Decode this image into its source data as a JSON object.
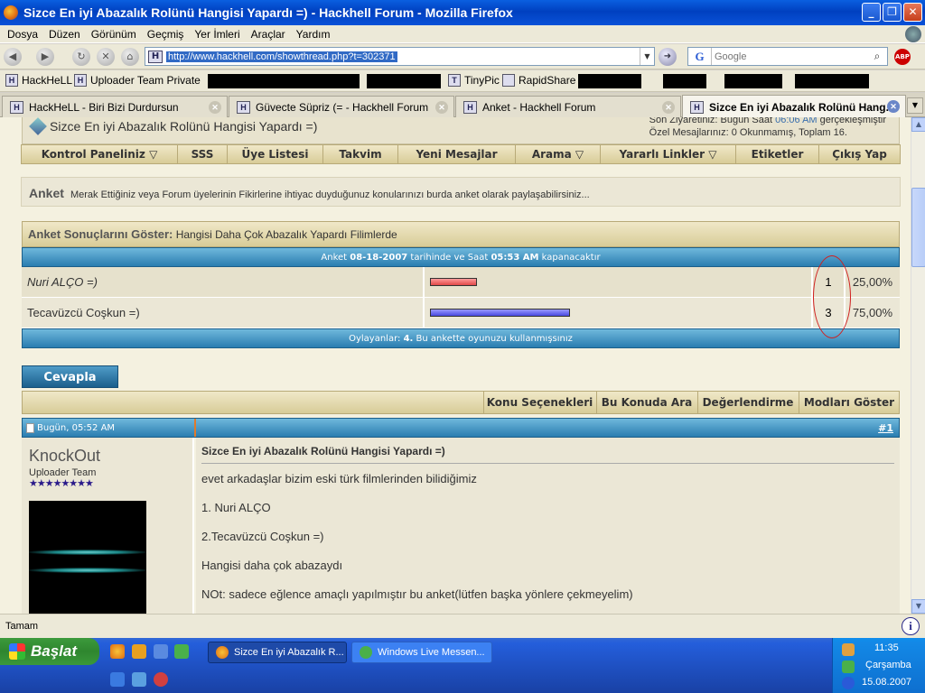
{
  "window": {
    "title": "Sizce En iyi Abazalık Rolünü Hangisi Yapardı =) - Hackhell Forum - Mozilla Firefox",
    "buttons": [
      "_",
      "❐",
      "✕"
    ]
  },
  "menu": [
    "Dosya",
    "Düzen",
    "Görünüm",
    "Geçmiş",
    "Yer İmleri",
    "Araçlar",
    "Yardım"
  ],
  "nav": {
    "url": "http://www.hackhell.com/showthread.php?t=302371",
    "search_placeholder": "Google",
    "search_engine_icon": "G",
    "abp_label": "ABP"
  },
  "bookmarks": [
    {
      "label": "HackHeLL",
      "icon": "hackhell-icon"
    },
    {
      "label": "Uploader Team Private",
      "icon": "hackhell-icon"
    },
    {
      "label": "TinyPic",
      "icon": "tinypic-icon"
    },
    {
      "label": "RapidShare",
      "icon": "page-icon"
    }
  ],
  "tabs": [
    {
      "label": "HackHeLL - Biri Bizi Durdursun",
      "active": false
    },
    {
      "label": "Güvecte Süpriz (= - Hackhell Forum",
      "active": false
    },
    {
      "label": "Anket - Hackhell Forum",
      "active": false
    },
    {
      "label": "Sizce En iyi Abazalık Rolünü Hang...",
      "active": true
    }
  ],
  "forum": {
    "thread_title": "Sizce En iyi Abazalık Rolünü Hangisi Yapardı =)",
    "last_visit_prefix": "Son Ziyaretiniz: Bugün Saat",
    "last_visit_time": "06:06 AM",
    "last_visit_suffix": "gerçekleşmiştir",
    "private_messages": "Özel Mesajlarınız: 0 Okunmamış, Toplam 16.",
    "navbar": [
      "Kontrol Paneliniz ▽",
      "SSS",
      "Üye Listesi",
      "Takvim",
      "Yeni Mesajlar",
      "Arama ▽",
      "Yararlı Linkler ▽",
      "Etiketler",
      "Çıkış Yap"
    ],
    "notice_label": "Anket",
    "notice_text": "Merak Ettiğiniz veya Forum üyelerinin Fikirlerine ihtiyac duyduğunuz konularınızı burda anket olarak paylaşabilirsiniz...",
    "poll": {
      "header_label": "Anket Sonuçlarını Göster:",
      "question": "Hangisi Daha Çok Abazalık Yapardı Filimlerde",
      "close_prefix": "Anket",
      "close_date": "08-18-2007",
      "close_mid": "tarihinde ve Saat",
      "close_time": "05:53 AM",
      "close_suffix": "kapanacaktır",
      "options": [
        {
          "label": "Nuri ALÇO =)",
          "votes": "1",
          "percent": "25,00%",
          "fraction": 0.25,
          "color": "#e04848"
        },
        {
          "label": "Tecavüzcü Coşkun =)",
          "votes": "3",
          "percent": "75,00%",
          "fraction": 0.75,
          "color": "#4848e0"
        }
      ],
      "voters_label": "Oylayanlar:",
      "voters_count": "4.",
      "voters_note": "Bu ankette oyunuzu kullanmışsınız"
    },
    "reply_button": "Cevapla",
    "thread_tools": [
      "Konu Seçenekleri ▽",
      "Bu Konuda Ara ▽",
      "Değerlendirme ▽",
      "Modları Göster ▽"
    ],
    "post": {
      "date": "Bugün, 05:52 AM",
      "number": "#1",
      "username": "KnockOut",
      "user_title": "Uploader Team",
      "stars": "★★★★★★★★",
      "title": "Sizce En iyi Abazalık Rolünü Hangisi Yapardı =)",
      "lines": [
        "evet arkadaşlar bizim eski türk filmlerinden bilidiğimiz",
        "1. Nuri ALÇO",
        "2.Tecavüzcü Coşkun =)",
        "Hangisi daha çok abazaydı",
        "NOt: sadece eğlence amaçlı yapılmıştır bu anket(lütfen başka yönlere çekmeyelim)"
      ]
    }
  },
  "status": {
    "text": "Tamam"
  },
  "taskbar": {
    "start": "Başlat",
    "tasks": [
      {
        "label": "Sizce En iyi Abazalık R...",
        "active": true
      },
      {
        "label": "Windows Live Messen...",
        "active": false
      }
    ],
    "clock": "11:35",
    "day": "Çarşamba",
    "date": "15.08.2007"
  }
}
